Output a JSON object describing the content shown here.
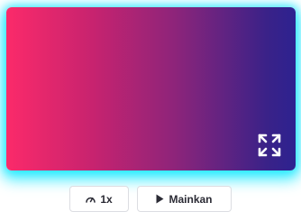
{
  "player": {
    "speed_label": "1x",
    "play_label": "Mainkan"
  },
  "icons": {
    "speed": "speedometer-icon",
    "play": "play-icon",
    "fullscreen": "fullscreen-icon"
  },
  "colors": {
    "gradient_start": "#fb2a6a",
    "gradient_end": "#2d2290",
    "glow": "#00e8ff"
  }
}
